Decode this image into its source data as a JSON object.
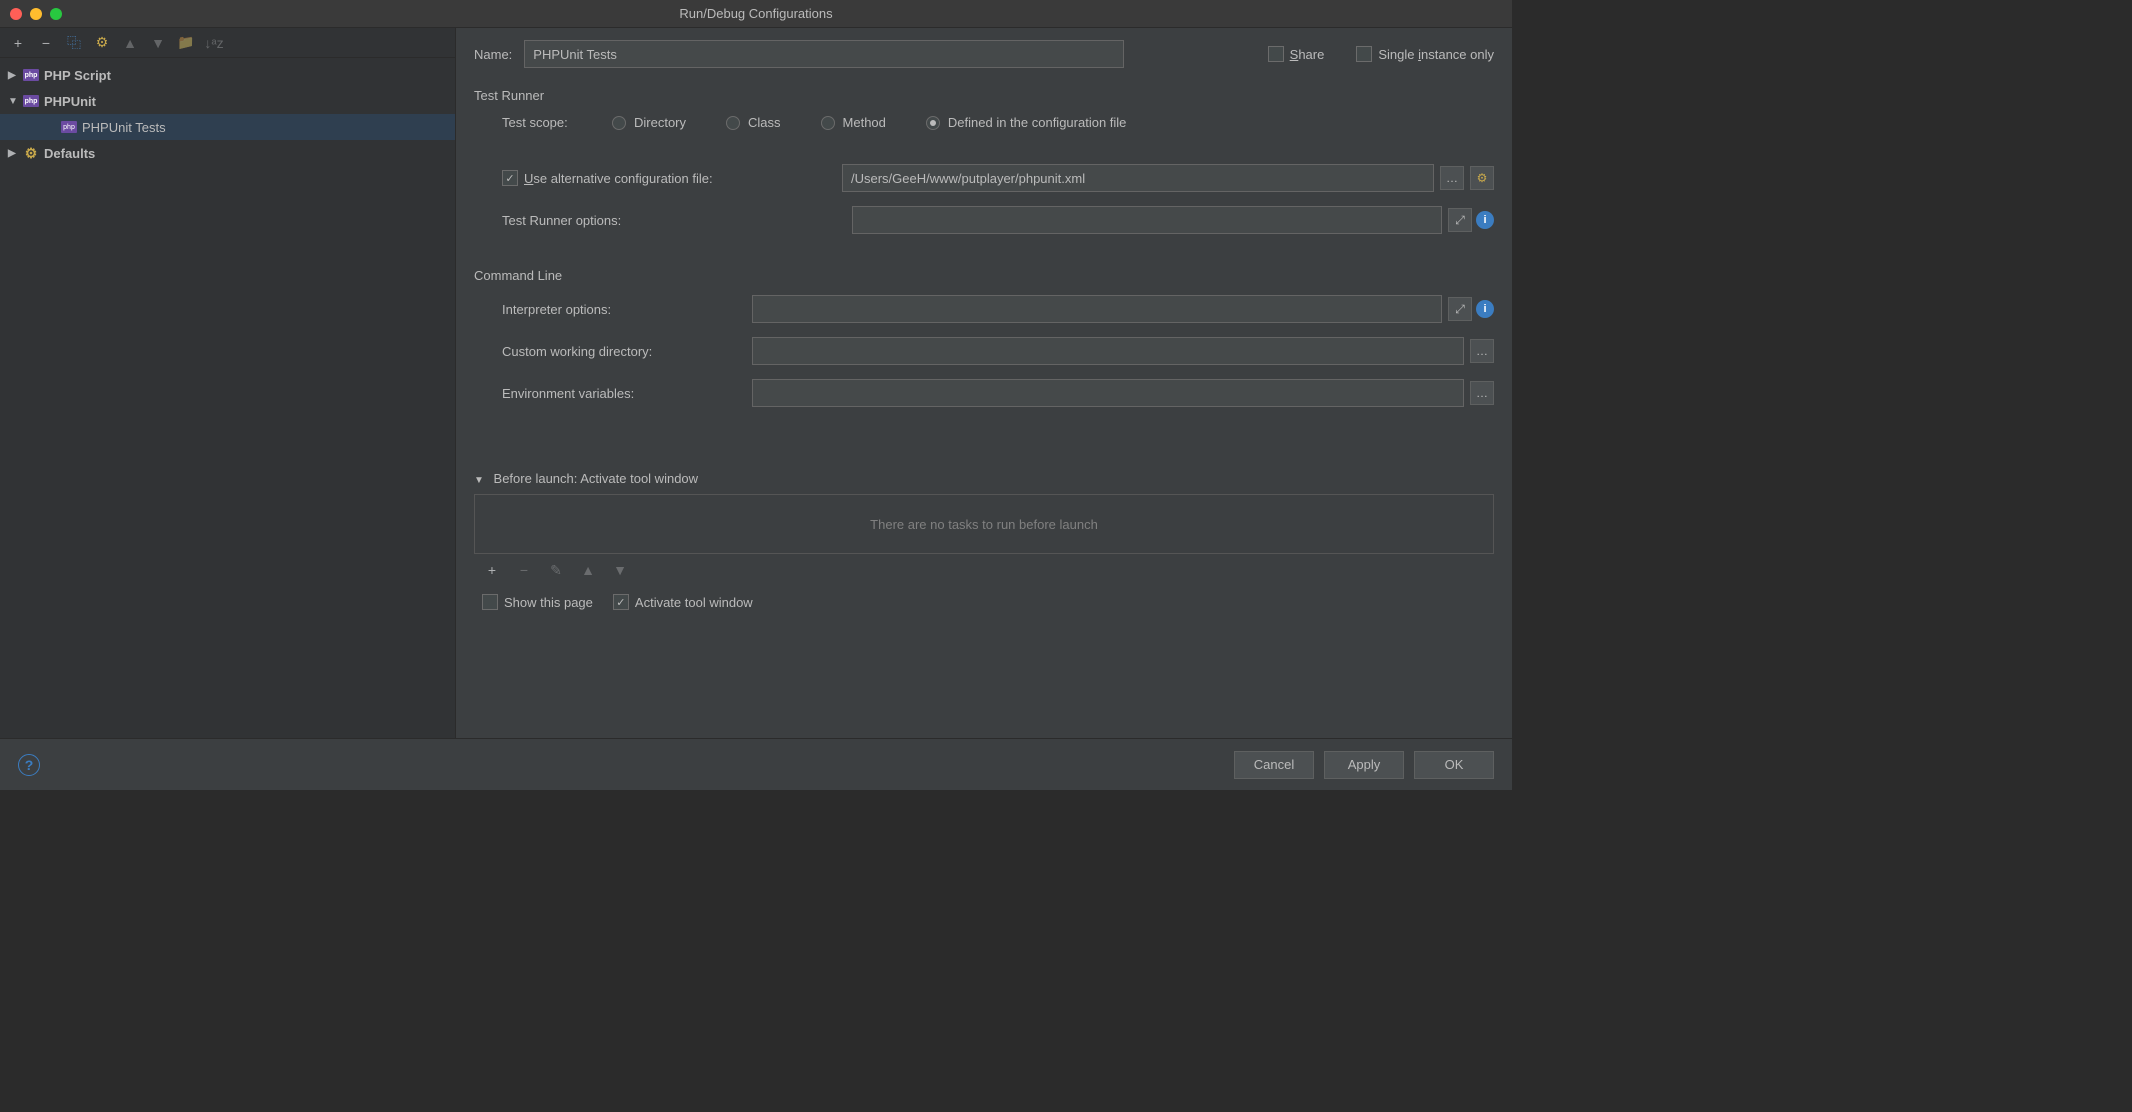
{
  "window": {
    "title": "Run/Debug Configurations"
  },
  "toolbar": {
    "add": "+",
    "remove": "−",
    "copy": "⿻",
    "edit": "⚙",
    "up": "▲",
    "down": "▼",
    "folder": "▢",
    "sort": "↓ᵃz"
  },
  "tree": {
    "phpScript": "PHP Script",
    "phpunit": "PHPUnit",
    "phpunitTests": "PHPUnit Tests",
    "defaults": "Defaults"
  },
  "form": {
    "nameLabel": "Name:",
    "nameValue": "PHPUnit Tests",
    "shareLabel": "Share",
    "singleInstanceLabel": "Single instance only"
  },
  "testRunner": {
    "title": "Test Runner",
    "scopeLabel": "Test scope:",
    "optDirectory": "Directory",
    "optClass": "Class",
    "optMethod": "Method",
    "optConfigFile": "Defined in the configuration file",
    "useAltConfigLabel": "Use alternative configuration file:",
    "altConfigValue": "/Users/GeeH/www/putplayer/phpunit.xml",
    "runnerOptionsLabel": "Test Runner options:",
    "runnerOptionsValue": ""
  },
  "commandLine": {
    "title": "Command Line",
    "interpreterLabel": "Interpreter options:",
    "interpreterValue": "",
    "workingDirLabel": "Custom working directory:",
    "workingDirValue": "",
    "envVarsLabel": "Environment variables:",
    "envVarsValue": ""
  },
  "beforeLaunch": {
    "title": "Before launch: Activate tool window",
    "emptyText": "There are no tasks to run before launch",
    "showPageLabel": "Show this page",
    "activateToolLabel": "Activate tool window"
  },
  "footer": {
    "cancel": "Cancel",
    "apply": "Apply",
    "ok": "OK"
  }
}
